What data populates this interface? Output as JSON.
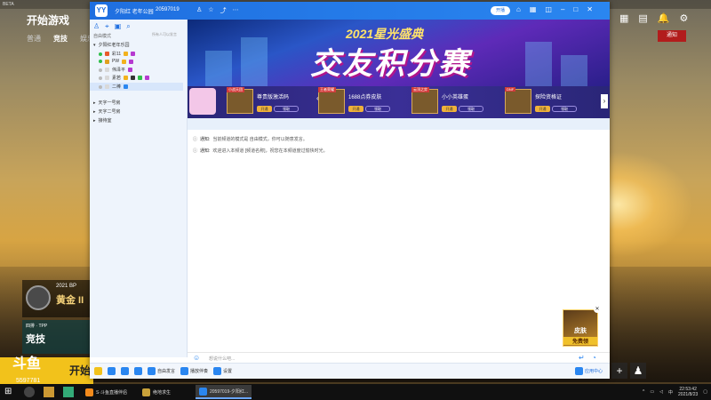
{
  "game": {
    "topbar_text": "BETA",
    "title": "开始游戏",
    "mode_tabs": [
      "普通",
      "竞技",
      "娱乐"
    ],
    "rank_year": "2021 BP",
    "rank_name": "黄金 II",
    "mode_card_sub": "四排 · TPP",
    "mode_card_title": "竞技",
    "start_label": "开始",
    "notice_label": "通知"
  },
  "douyu": {
    "logo": "斗鱼",
    "room_id": "5597781"
  },
  "yy": {
    "logo": "YY",
    "channel_name": "夕阳红 老年公园",
    "channel_id": "20597019",
    "open_label": "开播",
    "sidebar": {
      "hint": "所有人可以发言",
      "mode": "自由模式",
      "root": "夕阳红老年乐园",
      "members": [
        {
          "name": "彩11",
          "color": "#2fbf4a"
        },
        {
          "name": "PW",
          "color": "#e0a020"
        },
        {
          "name": "伟泽平",
          "color": "#999999"
        },
        {
          "name": "素若",
          "color": "#999999"
        },
        {
          "name": "二棒",
          "color": "#999999"
        }
      ],
      "channels": [
        "天字一号房",
        "天字二号房",
        "接待室"
      ]
    },
    "banner": {
      "subtitle": "2021星光盛典",
      "title": "交友积分赛"
    },
    "prizes": [
      {
        "tag": "小战天团",
        "name": "尊贵版激活码",
        "btn1": "开通",
        "btn2": "领取"
      },
      {
        "tag": "王者荣耀",
        "name": "1688点券皮肤",
        "btn1": "开通",
        "btn2": "领取"
      },
      {
        "tag": "云顶之弈",
        "name": "小小英雄蛋",
        "btn1": "开通",
        "btn2": "领取"
      },
      {
        "tag": "DNF",
        "name": "探险资格证",
        "btn1": "开通",
        "btn2": "领取"
      }
    ],
    "messages": [
      {
        "label": "通知:",
        "text": "当前频道的模式是 自由模式，你可以随意发言。"
      },
      {
        "label": "通知:",
        "text": "欢迎进入本频道 [频道名称]，祝您在本频道度过愉快时光。"
      }
    ],
    "input_placeholder": "想说什么吧...",
    "bottom": {
      "free_speak": "自由发言",
      "music": "播放伴奏",
      "settings": "设置",
      "app_center": "应用中心"
    },
    "skin_badge": {
      "line1": "皮肤",
      "line2": "免费领"
    }
  },
  "taskbar": {
    "apps": [
      {
        "label": "S·斗鱼直播伴侣",
        "color": "#f28a1c"
      },
      {
        "label": "绝地求生",
        "color": "#c9a23a"
      },
      {
        "label": "20597019-夕阳红...",
        "color": "#2a86f0"
      }
    ],
    "time": "22:53:42",
    "date": "2021/8/23"
  }
}
